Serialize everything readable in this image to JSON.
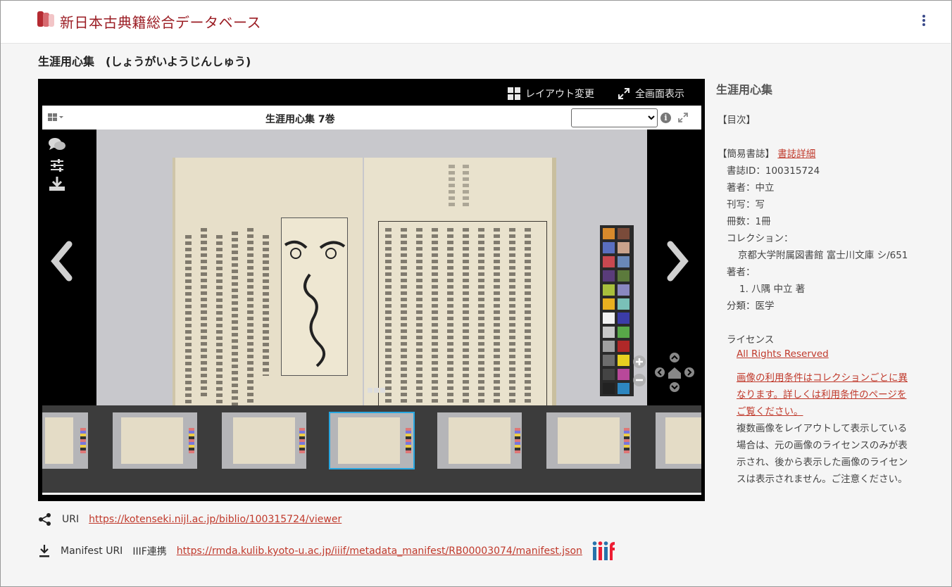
{
  "header": {
    "site_title": "新日本古典籍総合データベース"
  },
  "book_title": "生涯用心集　(しょうがいようじんしゅう)",
  "viewer": {
    "layout_label": "レイアウト変更",
    "fullscreen_label": "全画面表示",
    "inner_title": "生涯用心集 7巻",
    "page_select_value": "",
    "info_symbol": "i",
    "thumbnails_count": 7,
    "active_thumbnail_index": 3
  },
  "panel": {
    "title": "生涯用心集",
    "toc": "【目次】",
    "simple_biblio": "【簡易書誌】",
    "biblio_detail_link": "書誌詳細",
    "biblio_id": "書誌ID：100315724",
    "author": "著者：中立",
    "publication": "刊写：写",
    "volumes": "冊数：1冊",
    "collection_label": "コレクション：",
    "collection_value": "京都大学附属図書館 富士川文庫 シ/651",
    "authors_label": "著者：",
    "authors_item": "1. 八隅 中立 著",
    "category": "分類：医学",
    "license_label": "ライセンス",
    "license_link": "All Rights Reserved",
    "license_note_link_1": "画像の利用条件はコレクションごとに異",
    "license_note_link_2": "なります。詳しくは利用条件のページを",
    "license_note_link_3": "ご覧ください。",
    "license_note_1": "複数画像をレイアウトして表示している",
    "license_note_2": "場合は、元の画像のライセンスのみが表",
    "license_note_3": "示され、後から表示した画像のライセン",
    "license_note_4": "スは表示されません。ご注意ください。"
  },
  "links": {
    "uri_label": "URI",
    "uri_value": "https://kotenseki.nijl.ac.jp/biblio/100315724/viewer",
    "manifest_label": "Manifest URI",
    "iiif_label": "IIIF連携",
    "manifest_value": "https://rmda.kulib.kyoto-u.ac.jp/iiif/metadata_manifest/RB00003074/manifest.json"
  },
  "colors": {
    "brand": "#9b1d24",
    "link": "#c0392b",
    "active_thumb": "#28a7e0"
  }
}
